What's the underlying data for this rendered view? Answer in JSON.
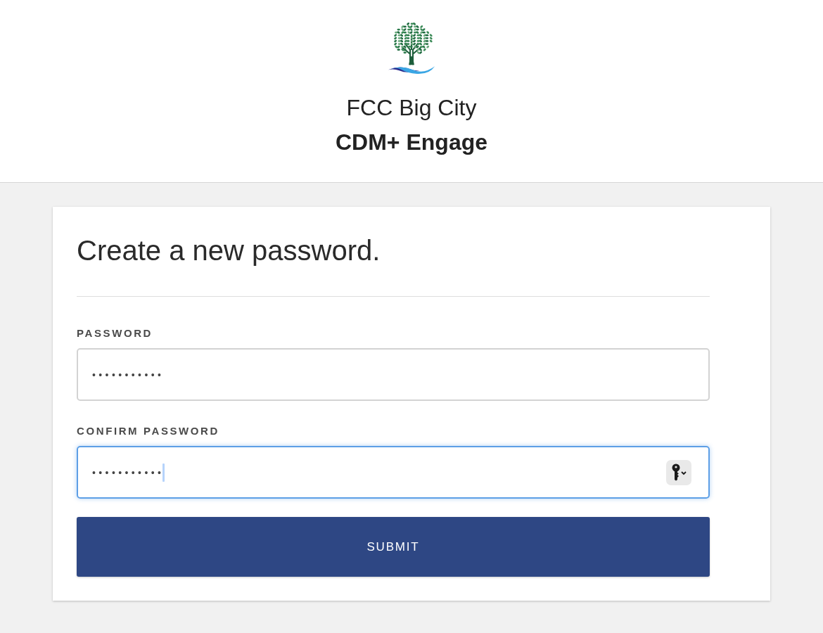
{
  "header": {
    "org_name": "FCC Big City",
    "app_name": "CDM+ Engage"
  },
  "form": {
    "title": "Create a new password.",
    "fields": [
      {
        "label": "PASSWORD",
        "value": "•••••••••••",
        "focused": false,
        "password_manager": false
      },
      {
        "label": "CONFIRM PASSWORD",
        "value": "•••••••••••",
        "focused": true,
        "password_manager": true
      }
    ],
    "submit": "SUBMIT"
  }
}
